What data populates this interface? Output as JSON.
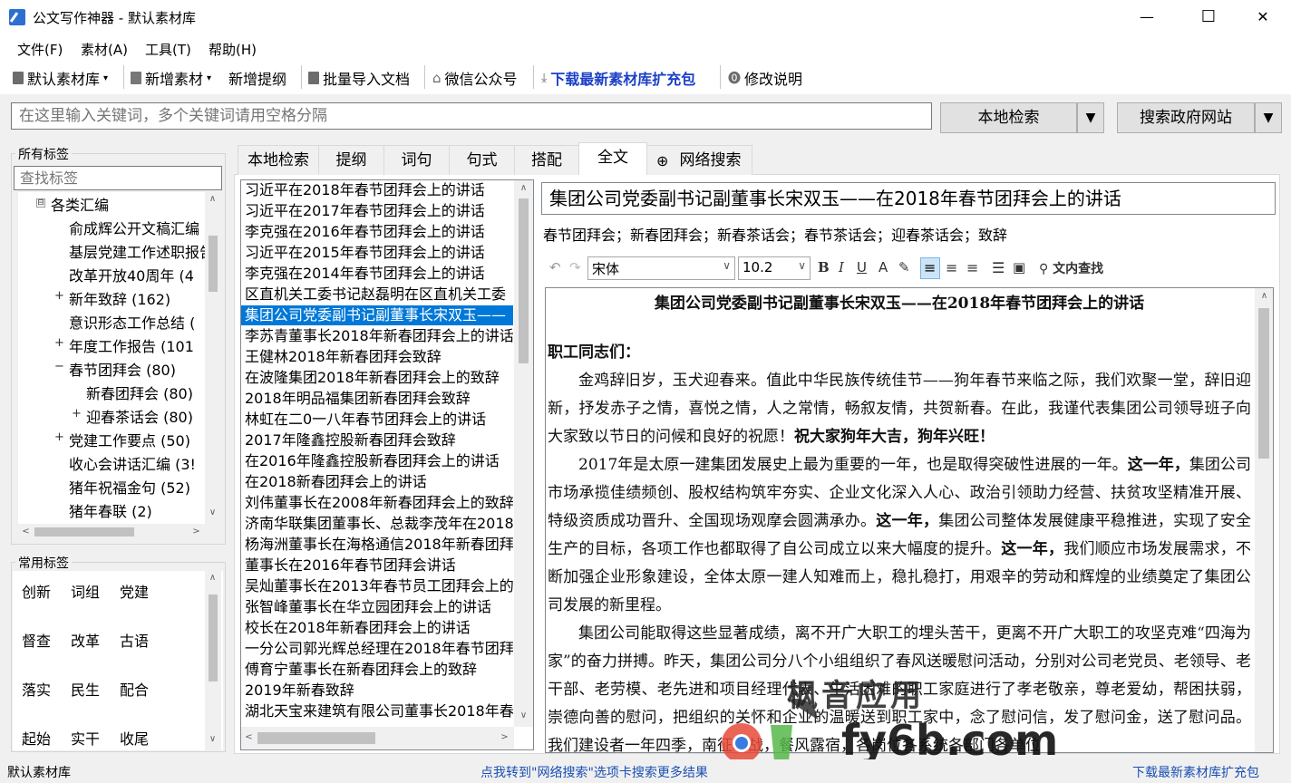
{
  "window": {
    "app_title": "公文写作神器",
    "separator": "-",
    "library_name": "默认素材库",
    "minimize": "—",
    "maximize": "☐",
    "close": "✕"
  },
  "menu": [
    "文件(F)",
    "素材(A)",
    "工具(T)",
    "帮助(H)"
  ],
  "toolbar": {
    "library": "默认素材库",
    "add_material": "新增素材",
    "add_outline": "新增提纲",
    "batch_import": "批量导入文档",
    "wechat": "微信公众号",
    "download": "下载最新素材库扩充包",
    "changelog": "修改说明"
  },
  "search": {
    "placeholder": "在这里输入关键词，多个关键词请用空格分隔",
    "local_search": "本地检索",
    "gov_search": "搜索政府网站",
    "drop_glyph": "▼"
  },
  "tags_panel": {
    "title": "所有标签",
    "filter_placeholder": "查找标签",
    "tree": [
      {
        "label": "各类汇编",
        "expander": "⊟"
      },
      {
        "label": "俞成辉公开文稿汇编",
        "expander": ""
      },
      {
        "label": "基层党建工作述职报告",
        "expander": ""
      },
      {
        "label": "改革开放40周年 (4",
        "expander": ""
      },
      {
        "label": "新年致辞 (162)",
        "expander": "+"
      },
      {
        "label": "意识形态工作总结 (",
        "expander": ""
      },
      {
        "label": "年度工作报告 (101",
        "expander": "+"
      },
      {
        "label": "春节团拜会 (80)",
        "expander": "−"
      },
      {
        "label": "新春团拜会 (80)",
        "expander": ""
      },
      {
        "label": "迎春茶话会 (80)",
        "expander": "+"
      },
      {
        "label": "党建工作要点 (50)",
        "expander": "+"
      },
      {
        "label": "收心会讲话汇编 (3!",
        "expander": ""
      },
      {
        "label": "猪年祝福金句 (52)",
        "expander": ""
      },
      {
        "label": "猪年春联 (2)",
        "expander": ""
      }
    ]
  },
  "common_tags": {
    "title": "常用标签",
    "rows": [
      [
        "创新",
        "词组",
        "党建"
      ],
      [
        "督查",
        "改革",
        "古语"
      ],
      [
        "落实",
        "民生",
        "配合"
      ],
      [
        "起始",
        "实干",
        "收尾"
      ]
    ]
  },
  "tabs": [
    "本地检索",
    "提纲",
    "词句",
    "句式",
    "搭配",
    "全文",
    "网络搜索"
  ],
  "article_list": [
    "习近平在2018年春节团拜会上的讲话",
    "习近平在2017年春节团拜会上的讲话",
    "李克强在2016年春节团拜会上的讲话",
    "习近平在2015年春节团拜会上的讲话",
    "李克强在2014年春节团拜会上的讲话",
    "区直机关工委书记赵磊明在区直机关工委",
    "集团公司党委副书记副董事长宋双玉——",
    "李苏青董事长2018年新春团拜会上的讲话",
    "王健林2018年新春团拜会致辞",
    "在波隆集团2018年新春团拜会上的致辞",
    "2018年明品福集团新春团拜会致辞",
    "林虹在二0一八年春节团拜会上的讲话",
    "2017年隆鑫控股新春团拜会致辞",
    "在2016年隆鑫控股新春团拜会上的讲话",
    "在2018新春团拜会上的讲话",
    "刘伟董事长在2008年新春团拜会上的致辞",
    "济南华联集团董事长、总裁李茂年在2018",
    "杨海洲董事长在海格通信2018年新春团拜",
    "董事长在2016年春节团拜会讲话",
    "吴灿董事长在2013年春节员工团拜会上的",
    "张智峰董事长在华立园团拜会上的讲话",
    "校长在2018年新春团拜会上的讲话",
    "一分公司郭光辉总经理在2018年春节团拜",
    "傅育宁董事长在新春团拜会上的致辞",
    "2019年新春致辞",
    "湖北天宝来建筑有限公司董事长2018年春"
  ],
  "document": {
    "title": "集团公司党委副书记副董事长宋双玉——在2018年春节团拜会上的讲话",
    "keywords": "春节团拜会；新春团拜会；新春茶话会；春节茶话会；迎春茶话会；致辞",
    "font": "宋体",
    "size": "10.2",
    "find_label": "文内查找",
    "heading": "集团公司党委副书记副董事长宋双玉——在2018年春节团拜会上的讲话",
    "salutation": "职工同志们：",
    "p1": "金鸡辞旧岁，玉犬迎春来。值此中华民族传统佳节——狗年春节来临之际，我们欢聚一堂，辞旧迎新，抒发赤子之情，喜悦之情，人之常情，畅叙友情，共贺新春。在此，我谨代表集团公司领导班子向大家致以节日的问候和良好的祝愿！",
    "p1_bold": "祝大家狗年大吉，狗年兴旺！",
    "p2a": "2017年是太原一建集团发展史上最为重要的一年，也是取得突破性进展的一年。",
    "p2_bold1": "这一年，",
    "p2b": "集团公司市场承揽佳绩频创、股权结构筑牢夯实、企业文化深入人心、政治引领助力经营、扶贫攻坚精准开展、特级资质成功晋升、全国现场观摩会圆满承办。",
    "p2_bold2": "这一年，",
    "p2c": "集团公司整体发展健康平稳推进，实现了安全生产的目标，各项工作也都取得了自公司成立以来大幅度的提升。",
    "p2_bold3": "这一年，",
    "p2d": "我们顺应市场发展需求，不断加强企业形象建设，全体太原一建人知难而上，稳扎稳打，用艰辛的劳动和辉煌的业绩奠定了集团公司发展的新里程。",
    "p3": "集团公司能取得这些显著成绩，离不开广大职工的埋头苦干，更离不开广大职工的攻坚克难“四海为家”的奋力拼搏。昨天，集团公司分八个小组组织了春风送暖慰问活动，分别对公司老党员、老领导、老干部、老劳模、老先进和项目经理代表、生活困难的职工家庭进行了孝老敬亲，尊老爱幼，帮困扶弱，崇德向善的慰问，把组织的关怀和企业的温暖送到职工家中，念了慰问信，发了慰问金，送了慰问品。我们建设者一年四季，南征北战，餐风露宿，各岗位各系统各部门各单位"
  },
  "status": {
    "left": "默认素材库",
    "center": "点我转到\"网络搜索\"选项卡搜索更多结果",
    "right": "下载最新素材库扩充包"
  },
  "watermark": {
    "text1": "枫音应用",
    "text2": "fy6b.com"
  }
}
